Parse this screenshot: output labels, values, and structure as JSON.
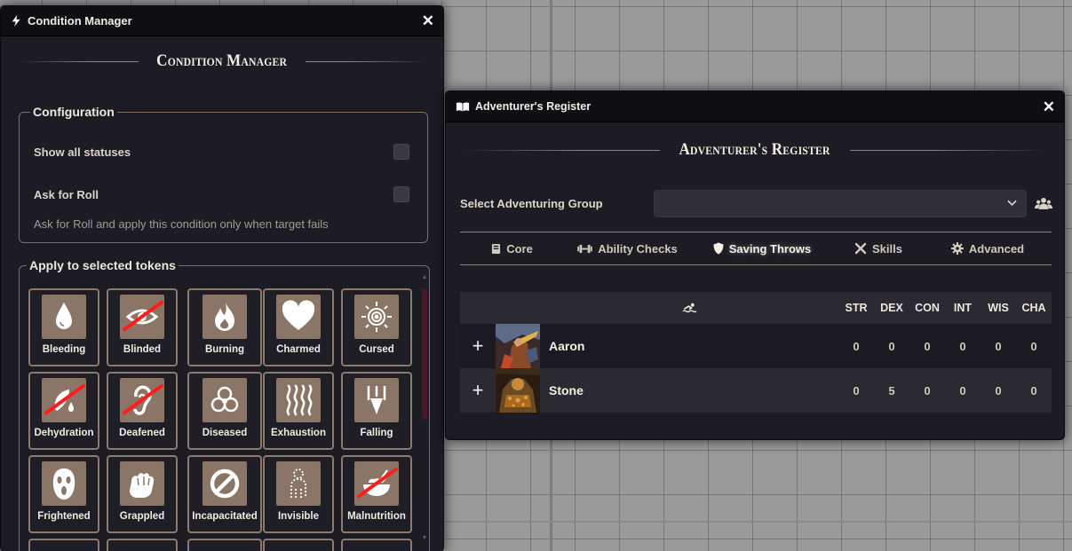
{
  "condition_manager": {
    "window_title": "Condition Manager",
    "banner_title": "Condition Manager",
    "configuration": {
      "legend": "Configuration",
      "show_all_statuses": "Show all statuses",
      "ask_for_roll": "Ask for Roll",
      "ask_for_roll_hint": "Ask for Roll and apply this condition only when target fails"
    },
    "apply": {
      "legend": "Apply to selected tokens",
      "conditions": [
        {
          "label": "Bleeding",
          "icon": "blood-drop-icon"
        },
        {
          "label": "Blinded",
          "icon": "blinded-eye-icon"
        },
        {
          "label": "Burning",
          "icon": "flame-icon"
        },
        {
          "label": "Charmed",
          "icon": "heart-icon"
        },
        {
          "label": "Cursed",
          "icon": "spiral-sun-icon"
        },
        {
          "label": "Dehydration",
          "icon": "dehydration-icon"
        },
        {
          "label": "Deafened",
          "icon": "deafened-ear-icon"
        },
        {
          "label": "Diseased",
          "icon": "biohazard-icon"
        },
        {
          "label": "Exhaustion",
          "icon": "heat-waves-icon"
        },
        {
          "label": "Falling",
          "icon": "falling-arrow-icon"
        },
        {
          "label": "Frightened",
          "icon": "scream-mask-icon"
        },
        {
          "label": "Grappled",
          "icon": "grab-fist-icon"
        },
        {
          "label": "Incapacitated",
          "icon": "prohibited-icon"
        },
        {
          "label": "Invisible",
          "icon": "invisible-figure-icon"
        },
        {
          "label": "Malnutrition",
          "icon": "malnutrition-bowl-icon"
        }
      ]
    }
  },
  "adventurers_register": {
    "window_title": "Adventurer's Register",
    "banner_title": "Adventurer's Register",
    "select_label": "Select Adventuring Group",
    "select_value": "",
    "tabs": [
      {
        "label": "Core",
        "icon": "book-icon"
      },
      {
        "label": "Ability Checks",
        "icon": "dumbbell-icon"
      },
      {
        "label": "Saving Throws",
        "icon": "shield-icon",
        "active": true
      },
      {
        "label": "Skills",
        "icon": "crossed-tools-icon"
      },
      {
        "label": "Advanced",
        "icon": "gear-icon"
      }
    ],
    "saving_throws": {
      "header_icon": "swimmer-icon",
      "columns": [
        "STR",
        "DEX",
        "CON",
        "INT",
        "WIS",
        "CHA"
      ],
      "rows": [
        {
          "name": "Aaron",
          "values": [
            "0",
            "0",
            "0",
            "0",
            "0",
            "0"
          ]
        },
        {
          "name": "Stone",
          "values": [
            "0",
            "5",
            "0",
            "0",
            "0",
            "0"
          ]
        }
      ]
    }
  },
  "colors": {
    "accent_gold": "#b07f3a",
    "window_bg": "#1d1b24",
    "tile_icon_bg": "#8a7566",
    "strike_red": "#ff1b1b",
    "scrollbar": "#4b1727"
  }
}
